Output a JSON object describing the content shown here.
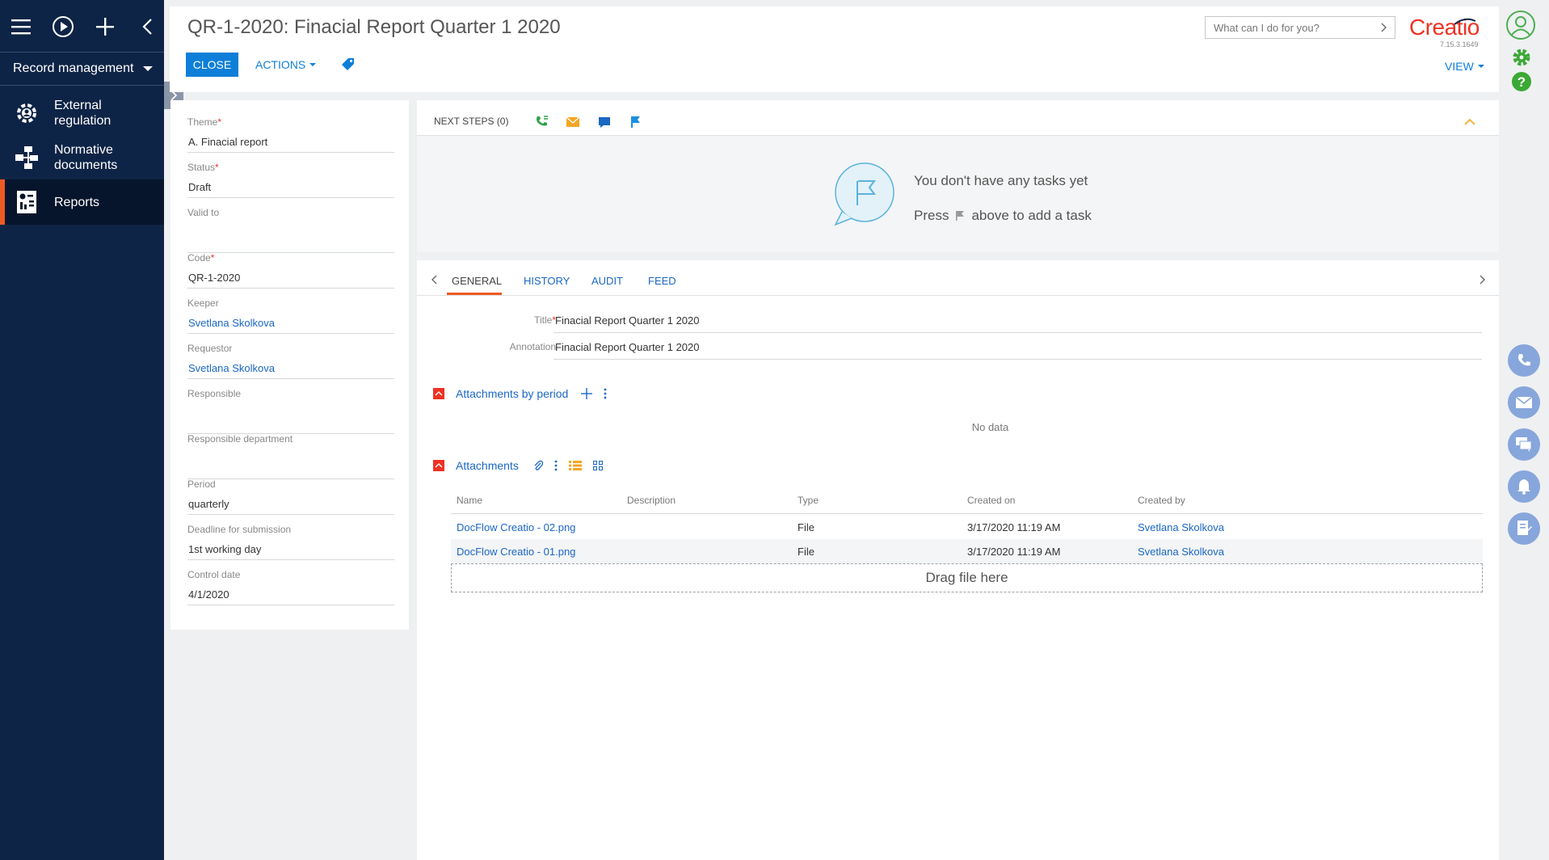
{
  "sidebar": {
    "section_label": "Record management",
    "items": [
      {
        "label": "External regulation",
        "icon": "external-regulation-icon"
      },
      {
        "label": "Normative documents",
        "icon": "normative-documents-icon"
      },
      {
        "label": "Reports",
        "icon": "reports-icon",
        "active": true
      }
    ]
  },
  "header": {
    "title": "QR-1-2020: Finacial Report Quarter 1 2020",
    "close_label": "CLOSE",
    "actions_label": "ACTIONS",
    "search_placeholder": "What can I do for you?",
    "logo_text": "Creatio",
    "version": "7.15.3.1649",
    "view_label": "VIEW"
  },
  "form": {
    "fields": [
      {
        "label": "Theme",
        "required": true,
        "value": "A. Finacial report",
        "link": false
      },
      {
        "label": "Status",
        "required": true,
        "value": "Draft",
        "link": false
      },
      {
        "label": "Valid to",
        "required": false,
        "value": "",
        "link": false
      },
      {
        "label": "Code",
        "required": true,
        "value": "QR-1-2020",
        "link": false
      },
      {
        "label": "Keeper",
        "required": false,
        "value": "Svetlana Skolkova",
        "link": true
      },
      {
        "label": "Requestor",
        "required": false,
        "value": "Svetlana Skolkova",
        "link": true
      },
      {
        "label": "Responsible",
        "required": false,
        "value": "",
        "link": false
      },
      {
        "label": "Responsible department",
        "required": false,
        "value": "",
        "link": false
      },
      {
        "label": "Period",
        "required": false,
        "value": "quarterly",
        "link": false
      },
      {
        "label": "Deadline for submission",
        "required": false,
        "value": "1st working day",
        "link": false
      },
      {
        "label": "Control date",
        "required": false,
        "value": "4/1/2020",
        "link": false
      }
    ]
  },
  "next_steps": {
    "label": "NEXT STEPS (0)",
    "empty_line1": "You don't have any tasks yet",
    "empty_press": "Press",
    "empty_after": "above to add a task"
  },
  "tabs": {
    "items": [
      "GENERAL",
      "HISTORY",
      "AUDIT",
      "FEED"
    ],
    "active": 0
  },
  "general": {
    "title_label": "Title",
    "title_value": "Finacial Report Quarter 1 2020",
    "annotation_label": "Annotation",
    "annotation_value": "Finacial Report Quarter 1 2020"
  },
  "attachments_by_period": {
    "title": "Attachments by period",
    "empty": "No data"
  },
  "attachments": {
    "title": "Attachments",
    "columns": [
      "Name",
      "Description",
      "Type",
      "Created on",
      "Created by"
    ],
    "rows": [
      {
        "name": "DocFlow Creatio - 02.png",
        "description": "",
        "type": "File",
        "created_on": "3/17/2020 11:19 AM",
        "created_by": "Svetlana Skolkova"
      },
      {
        "name": "DocFlow Creatio - 01.png",
        "description": "",
        "type": "File",
        "created_on": "3/17/2020 11:19 AM",
        "created_by": "Svetlana Skolkova"
      }
    ],
    "dropzone": "Drag file here"
  },
  "colors": {
    "sidebar_bg": "#0e2446",
    "accent_orange": "#ee5a24",
    "brand_red": "#ee3224",
    "primary_blue": "#0e7fd8",
    "link_blue": "#1b67c4",
    "rail_button": "#87a6db",
    "green": "#4caf50"
  }
}
